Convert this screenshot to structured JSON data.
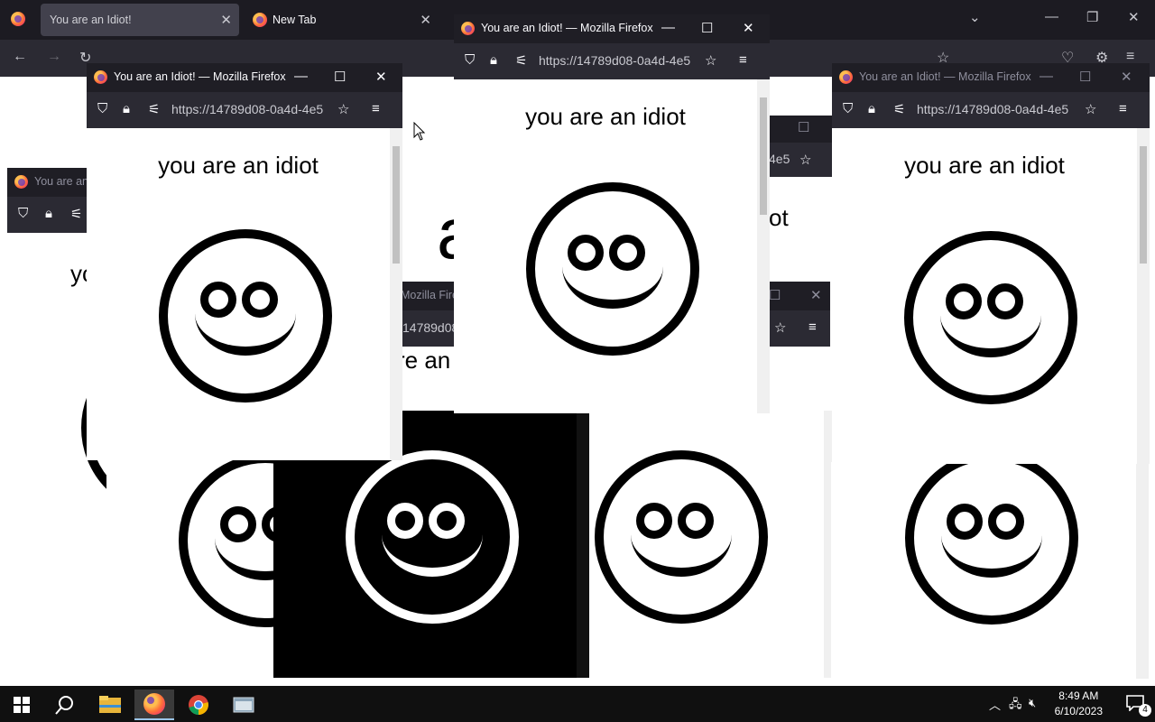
{
  "main_browser": {
    "tabs": [
      {
        "label": "You are an Idiot!",
        "active": true
      },
      {
        "label": "New Tab",
        "active": false
      }
    ],
    "url": "https://14789d08-0a4d-4e5"
  },
  "popups": {
    "title": "You are an Idiot! — Mozilla Firefox",
    "title_partial": "You are an",
    "title_partial2": "Mozilla Firefo",
    "url": "https://14789d08-0a4d-4e5",
    "url_partial": "14789d08",
    "url_partial2": "4e5",
    "message": "you are an idiot",
    "message_partial_left": "yo",
    "message_partial_mid": "re an",
    "message_partial_right": "ot",
    "message_partial_big": "a"
  },
  "taskbar": {
    "time": "8:49 AM",
    "date": "6/10/2023",
    "notification_count": "4"
  },
  "icons": {
    "back": "back-arrow-icon",
    "forward": "forward-arrow-icon",
    "reload": "reload-icon",
    "shield": "shield-icon",
    "lock": "lock-icon",
    "bookmark": "star-icon",
    "menu": "hamburger-menu-icon"
  }
}
